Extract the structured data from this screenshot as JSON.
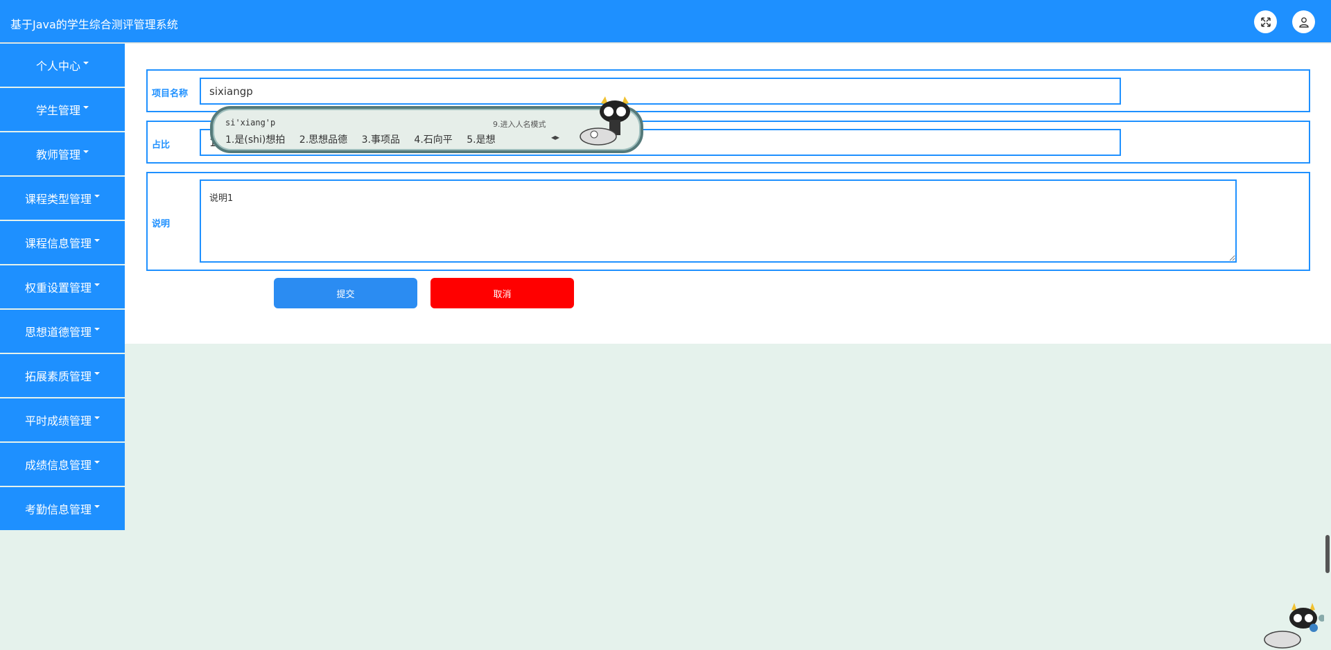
{
  "app": {
    "title": "基于Java的学生综合测评管理系统"
  },
  "header": {
    "fullscreen_icon": "expand-icon",
    "user_icon": "user-icon"
  },
  "sidebar": {
    "items": [
      {
        "label": "个人中心"
      },
      {
        "label": "学生管理"
      },
      {
        "label": "教师管理"
      },
      {
        "label": "课程类型管理"
      },
      {
        "label": "课程信息管理"
      },
      {
        "label": "权重设置管理"
      },
      {
        "label": "思想道德管理"
      },
      {
        "label": "拓展素质管理"
      },
      {
        "label": "平时成绩管理"
      },
      {
        "label": "成绩信息管理"
      },
      {
        "label": "考勤信息管理"
      }
    ]
  },
  "form": {
    "project_name": {
      "label": "项目名称",
      "value": "sixiangp"
    },
    "ratio": {
      "label": "占比",
      "value": "1"
    },
    "description": {
      "label": "说明",
      "value": "说明1"
    },
    "submit_label": "提交",
    "cancel_label": "取消"
  },
  "ime": {
    "composition": "si'xiang'p",
    "hint": "9.进入人名模式",
    "candidates": [
      "1.是(shi)想拍",
      "2.思想品德",
      "3.事项品",
      "4.石向平",
      "5.是想"
    ]
  },
  "colors": {
    "primary": "#1e90ff",
    "danger": "#ff0000",
    "background": "#e5f2ec"
  }
}
